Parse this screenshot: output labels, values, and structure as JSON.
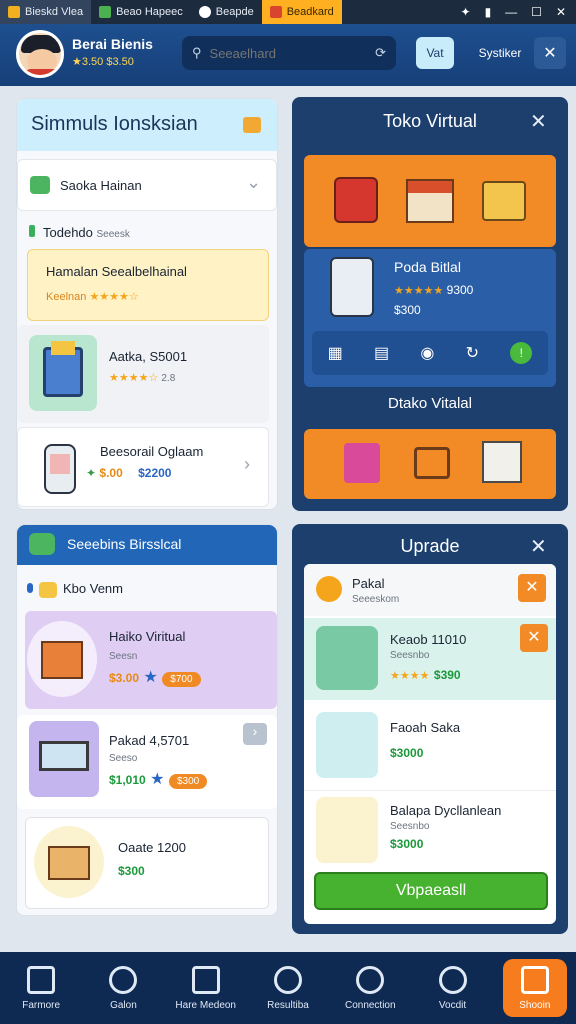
{
  "tabs": [
    "Bieskd Vlea",
    "Beao Hapeec",
    "Beapde",
    "Beadkard"
  ],
  "header": {
    "user_name": "Berai Bienis",
    "user_coins": "★3.50 $3.50",
    "search_placeholder": "Seeaelhard",
    "vat_label": "Vat",
    "settings_label": "Systiker"
  },
  "sim": {
    "title": "Simmuls Ionsksian",
    "dropdown": "Saoka Hainan",
    "filter_label": "Todehdo",
    "filter_sub": "Seeesk",
    "highlight": {
      "title": "Hamalan Seealbelhainal",
      "sub": "Keelnan",
      "stars": "★★★★☆"
    },
    "item1": {
      "title": "Aatka, S5001",
      "stars": "★★★★☆",
      "rating": "2.8"
    },
    "item2": {
      "title": "Beesorail Oglaam",
      "price1": "$.00",
      "price2": "$2200"
    }
  },
  "toko": {
    "title": "Toko Virtual",
    "featured": {
      "title": "Poda Bitlal",
      "stars": "★★★★★",
      "rating": "9300",
      "price": "$300"
    },
    "subtitle": "Dtako Vitalal"
  },
  "store2": {
    "header": "Seeebins Birsslcal",
    "section": "Kbo Venm",
    "item1": {
      "title": "Haiko Viritual",
      "sub": "Seesn",
      "price": "$3.00",
      "pill": "$700"
    },
    "item2": {
      "title": "Pakad 4,5701",
      "sub": "Seeso",
      "price": "$1,010",
      "pill": "$300"
    },
    "item3": {
      "title": "Oaate 1200",
      "price": "$300"
    }
  },
  "upgrade": {
    "title": "Uprade",
    "row0": {
      "title": "Pakal",
      "sub": "Seeeskom"
    },
    "row1": {
      "title": "Keaob 11010",
      "sub": "Seesnbo",
      "stars": "★★★★",
      "price": "$390"
    },
    "row2": {
      "title": "Faoah Saka",
      "price": "$3000"
    },
    "row3": {
      "title": "Balapa Dycllanlean",
      "sub": "Seesnbo",
      "price": "$3000"
    },
    "button": "Vbpaeasll"
  },
  "nav": [
    "Farmore",
    "Galon",
    "Hare Medeon",
    "Resultiba",
    "Connection",
    "Vocdit",
    "Shooin"
  ]
}
